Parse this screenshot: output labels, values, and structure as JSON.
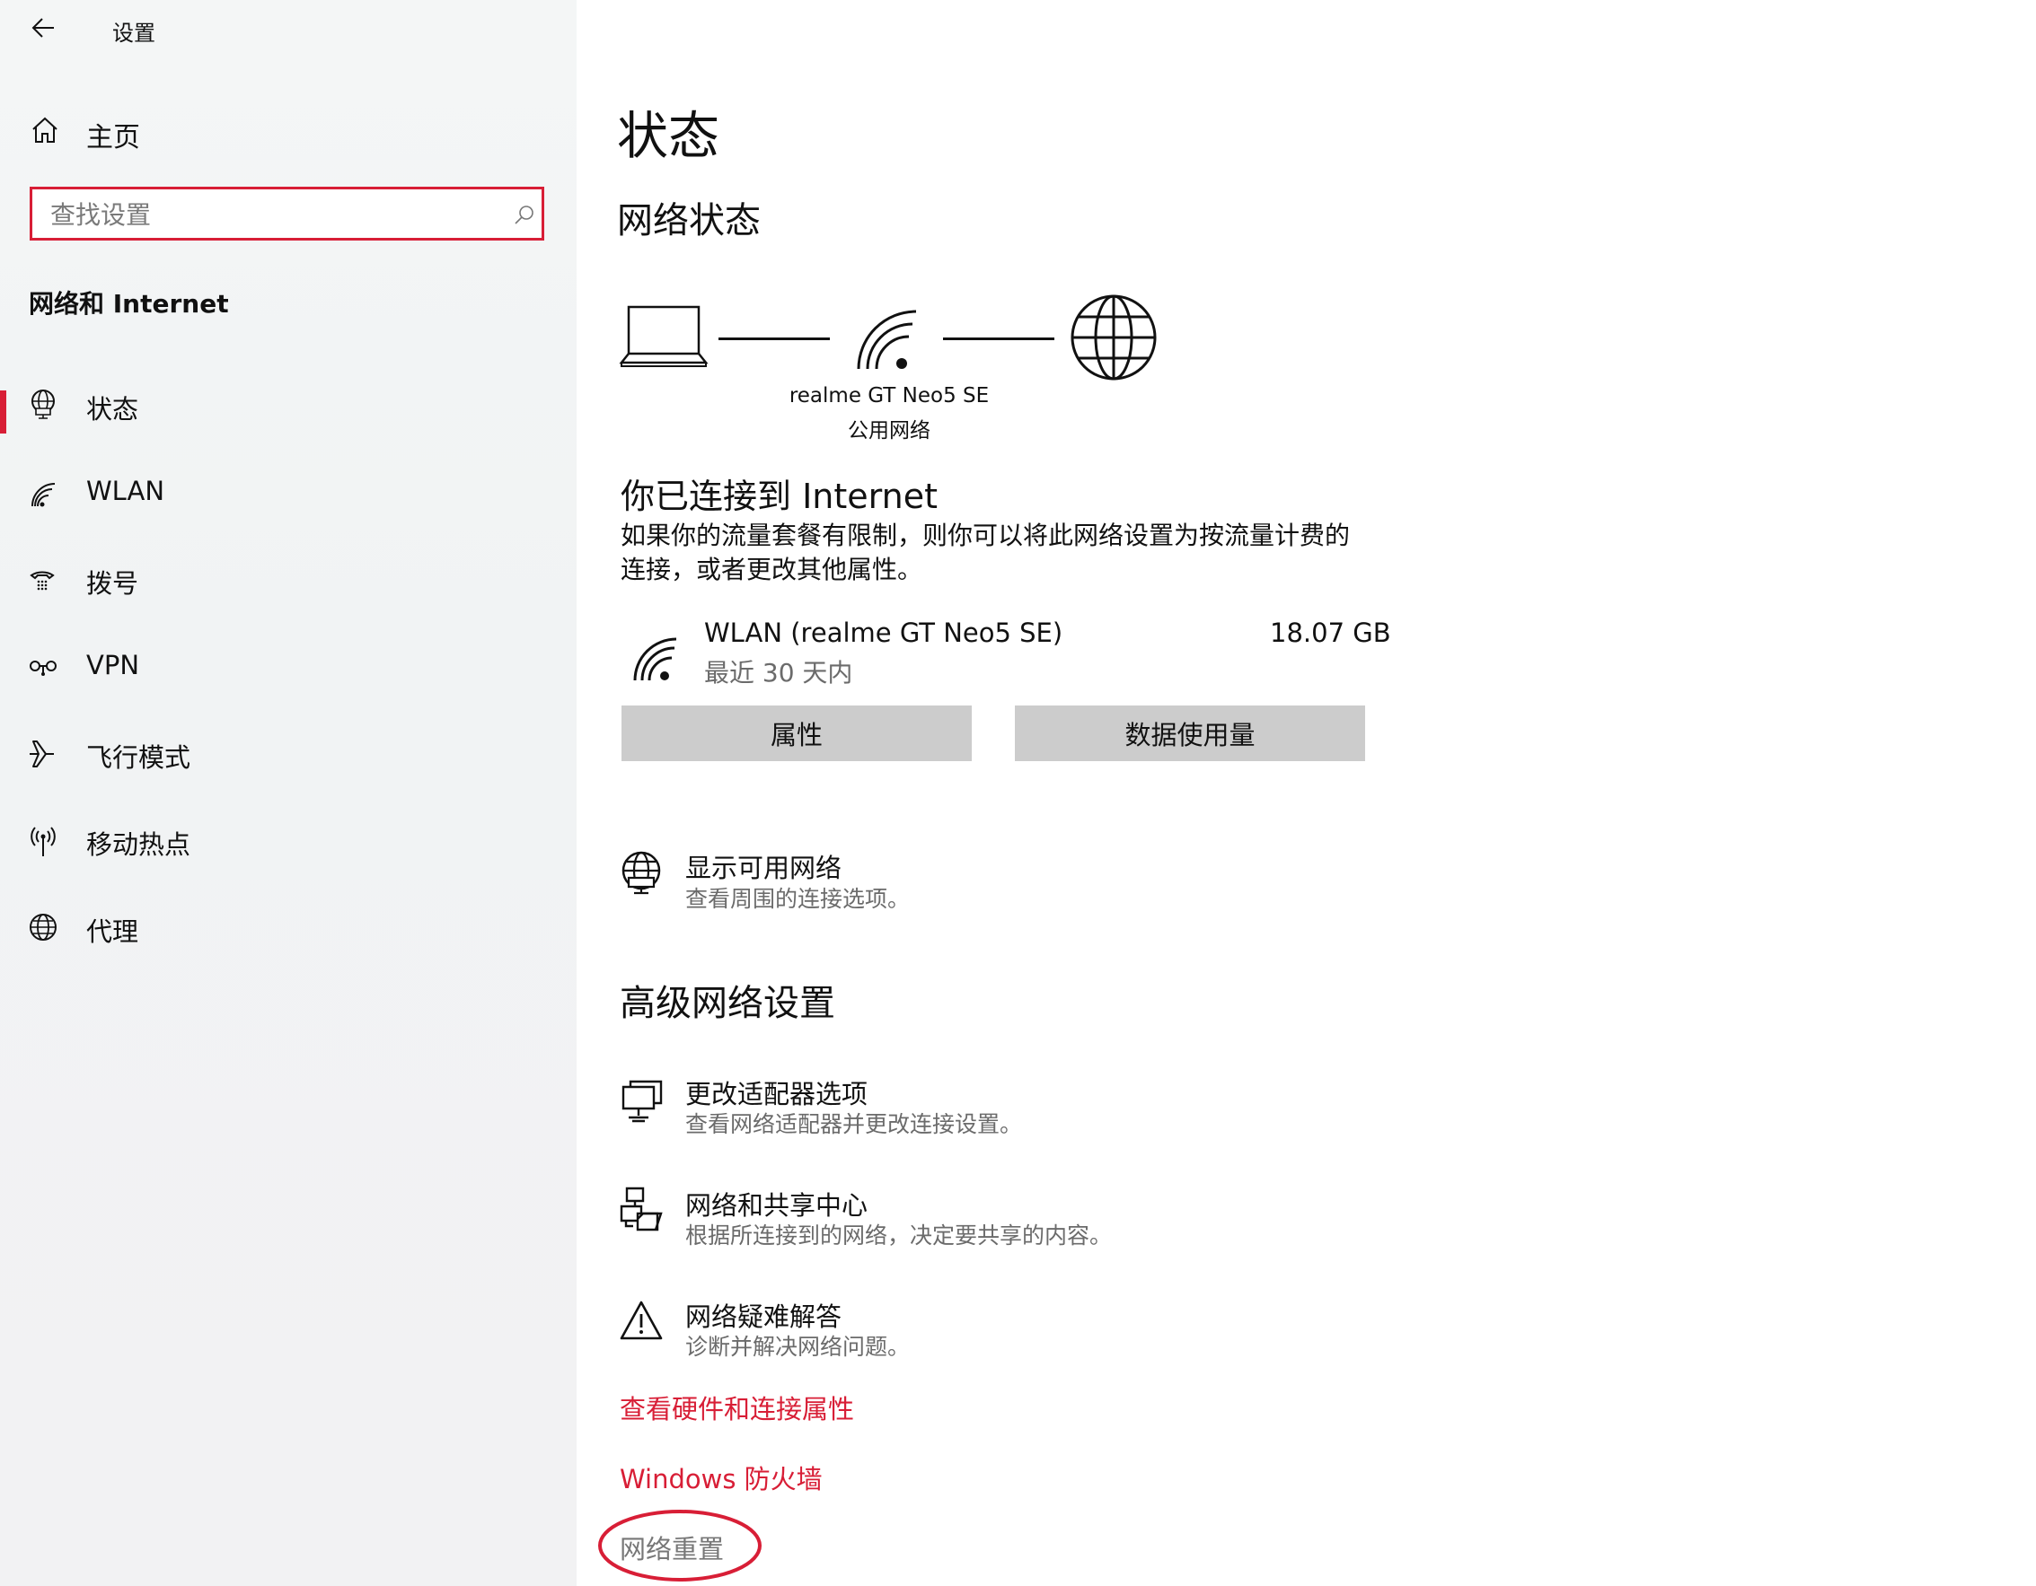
{
  "window": {
    "title": "设置"
  },
  "sidebar": {
    "home_label": "主页",
    "search_placeholder": "查找设置",
    "section_title": "网络和 Internet",
    "items": [
      {
        "label": "状态",
        "icon": "status-globe-icon",
        "selected": true
      },
      {
        "label": "WLAN",
        "icon": "wifi-icon"
      },
      {
        "label": "拨号",
        "icon": "dialup-icon"
      },
      {
        "label": "VPN",
        "icon": "vpn-icon"
      },
      {
        "label": "飞行模式",
        "icon": "airplane-icon"
      },
      {
        "label": "移动热点",
        "icon": "hotspot-icon"
      },
      {
        "label": "代理",
        "icon": "globe-icon"
      }
    ]
  },
  "main": {
    "page_title": "状态",
    "network_status_heading": "网络状态",
    "diagram": {
      "network_name": "realme GT Neo5 SE",
      "network_type": "公用网络"
    },
    "connected_heading": "你已连接到 Internet",
    "connected_desc_line1": "如果你的流量套餐有限制，则你可以将此网络设置为按流量计费的",
    "connected_desc_line2": "连接，或者更改其他属性。",
    "connection": {
      "name": "WLAN (realme GT Neo5 SE)",
      "period": "最近 30 天内",
      "usage": "18.07 GB"
    },
    "buttons": {
      "properties": "属性",
      "data_usage": "数据使用量"
    },
    "show_networks": {
      "title": "显示可用网络",
      "subtitle": "查看周围的连接选项。"
    },
    "advanced_heading": "高级网络设置",
    "advanced_items": [
      {
        "title": "更改适配器选项",
        "subtitle": "查看网络适配器并更改连接设置。",
        "icon": "adapter-icon"
      },
      {
        "title": "网络和共享中心",
        "subtitle": "根据所连接到的网络，决定要共享的内容。",
        "icon": "sharing-center-icon"
      },
      {
        "title": "网络疑难解答",
        "subtitle": "诊断并解决网络问题。",
        "icon": "warning-icon"
      }
    ],
    "links": {
      "hardware": "查看硬件和连接属性",
      "firewall": "Windows 防火墙",
      "reset": "网络重置"
    }
  },
  "colors": {
    "accent": "#d81e36",
    "button_bg": "#cccccc",
    "sidebar_bg": "#f2f3f4"
  }
}
